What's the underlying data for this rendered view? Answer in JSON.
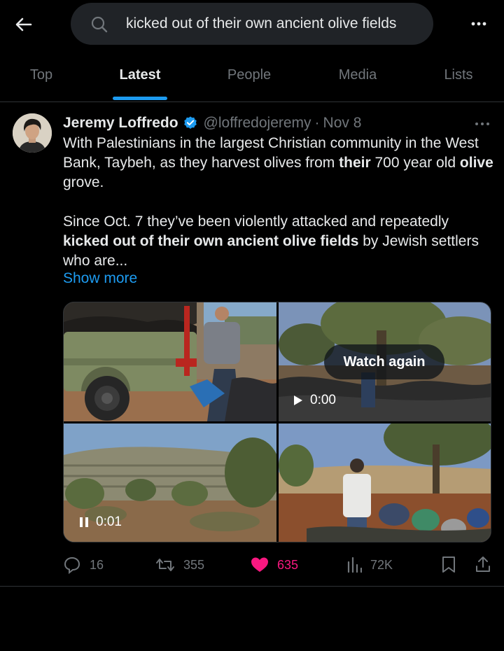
{
  "search": {
    "query": "kicked out of their own ancient olive fields"
  },
  "tabs": [
    {
      "label": "Top"
    },
    {
      "label": "Latest"
    },
    {
      "label": "People"
    },
    {
      "label": "Media"
    },
    {
      "label": "Lists"
    }
  ],
  "active_tab": "Latest",
  "tweet": {
    "author_name": "Jeremy Loffredo",
    "handle": "@loffredojeremy",
    "separator": "·",
    "date": "Nov 8",
    "verified": true,
    "paragraph1": {
      "t1": "With Palestinians in the largest Christian community in the West Bank, Taybeh, as they harvest olives from ",
      "b1": "their",
      "t2": " 700 year old ",
      "b2": "olive",
      "t3": " grove."
    },
    "paragraph2": {
      "t1": "Since Oct. 7 they’ve been violently attacked and repeatedly ",
      "b1": "kicked out of their own ancient olive fields",
      "t2": " by Jewish settlers who are..."
    },
    "show_more": "Show more",
    "media": {
      "watch_again": "Watch again",
      "video2_time": "0:00",
      "video3_time": "0:01"
    },
    "actions": {
      "replies": "16",
      "reposts": "355",
      "likes": "635",
      "views": "72K"
    }
  },
  "colors": {
    "background": "#000000",
    "accent": "#1d9bf0",
    "like": "#f91880",
    "muted": "#71767b",
    "search_bg": "#202327"
  },
  "icons": [
    "back-arrow-icon",
    "search-icon",
    "more-icon",
    "verified-badge-icon",
    "reply-icon",
    "repost-icon",
    "like-icon",
    "views-icon",
    "bookmark-icon",
    "share-icon",
    "play-icon",
    "pause-icon"
  ]
}
